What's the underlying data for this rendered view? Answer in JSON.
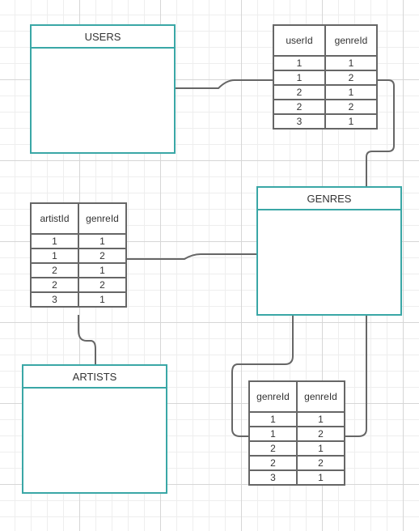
{
  "entities": {
    "users": {
      "title": "USERS"
    },
    "genres": {
      "title": "GENRES"
    },
    "artists": {
      "title": "ARTISTS"
    }
  },
  "user_genres": {
    "headers": [
      "userId",
      "genreId"
    ],
    "rows": [
      [
        "1",
        "1"
      ],
      [
        "1",
        "2"
      ],
      [
        "2",
        "1"
      ],
      [
        "2",
        "2"
      ],
      [
        "3",
        "1"
      ]
    ]
  },
  "artist_genres": {
    "headers": [
      "artistId",
      "genreId"
    ],
    "rows": [
      [
        "1",
        "1"
      ],
      [
        "1",
        "2"
      ],
      [
        "2",
        "1"
      ],
      [
        "2",
        "2"
      ],
      [
        "3",
        "1"
      ]
    ]
  },
  "genre_genres": {
    "headers": [
      "genreId",
      "genreId"
    ],
    "rows": [
      [
        "1",
        "1"
      ],
      [
        "1",
        "2"
      ],
      [
        "2",
        "1"
      ],
      [
        "2",
        "2"
      ],
      [
        "3",
        "1"
      ]
    ]
  },
  "colors": {
    "entity_border": "#3aa7a6",
    "line": "#666666"
  }
}
